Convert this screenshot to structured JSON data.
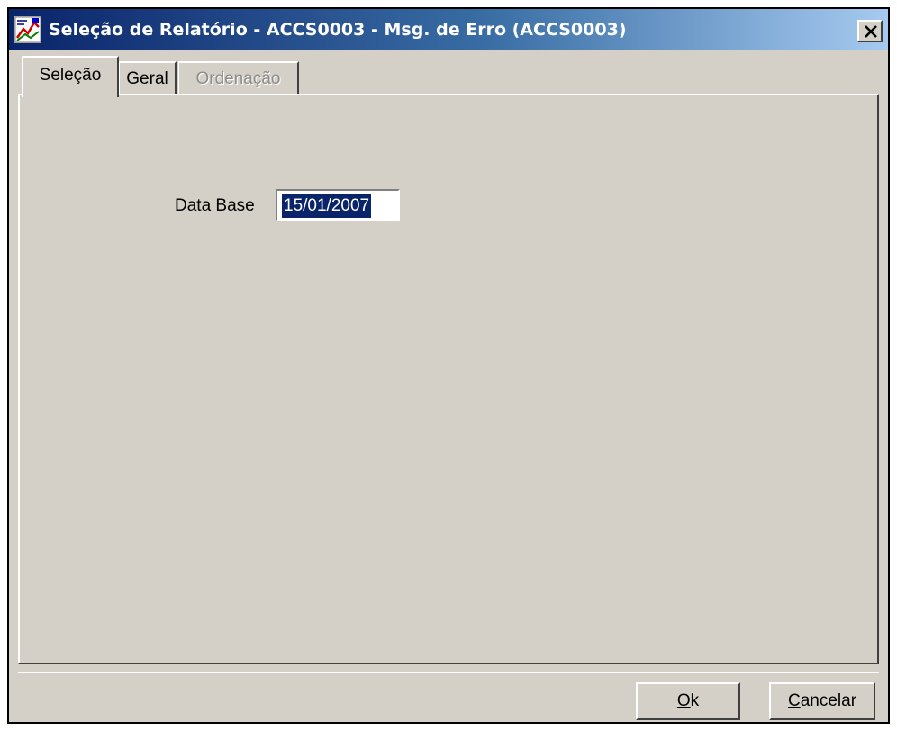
{
  "window": {
    "title": "Seleção de Relatório - ACCS0003 - Msg. de Erro (ACCS0003)",
    "close_glyph": "x"
  },
  "tabs": [
    {
      "label": "Seleção",
      "state": "selected"
    },
    {
      "label": "Geral",
      "state": "normal"
    },
    {
      "label": "Ordenação",
      "state": "disabled"
    }
  ],
  "form": {
    "data_base_label": "Data Base",
    "data_base_value": "15/01/2007"
  },
  "buttons": {
    "ok_mnemonic": "O",
    "ok_rest": "k",
    "cancelar_mnemonic": "C",
    "cancelar_rest": "ancelar"
  },
  "colors": {
    "titlebar_start": "#0a246a",
    "titlebar_end": "#a6caf0",
    "face": "#d4d0c8",
    "selection": "#0a246a",
    "disabled_text": "#8c8c8c"
  }
}
